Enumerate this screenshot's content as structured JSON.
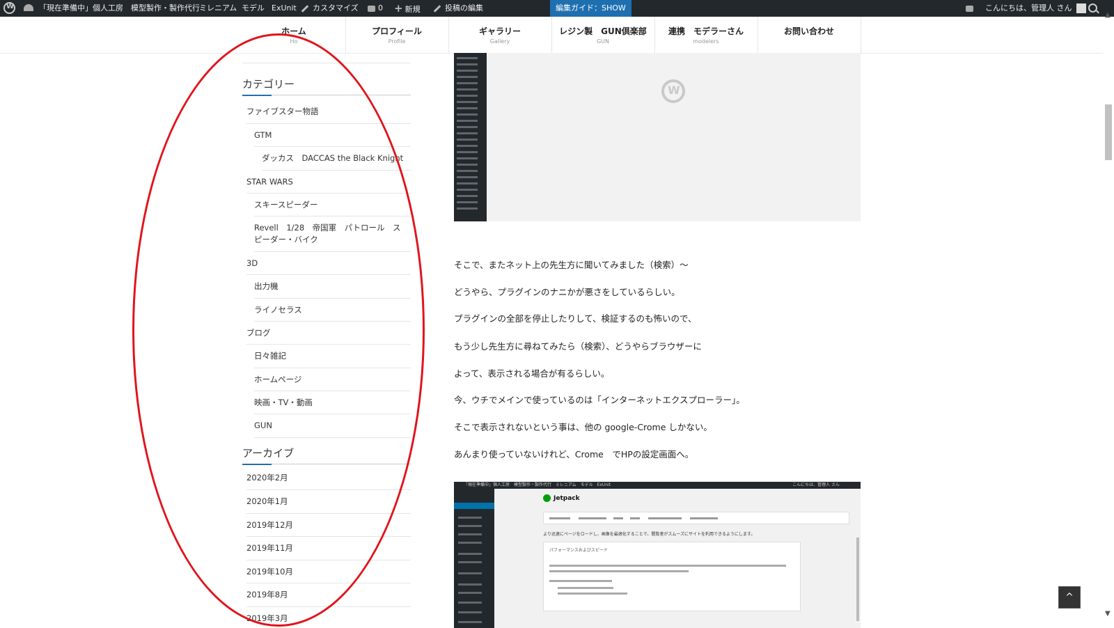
{
  "admin_bar": {
    "site_name": "「現在準備中」個人工房　模型製作・製作代行",
    "links": [
      "ミレニアム",
      "モデル",
      "ExUnit"
    ],
    "customize": "カスタマイズ",
    "comments_count": "0",
    "new_label": "新規",
    "edit_post": "投稿の編集",
    "guide": "編集ガイド：SHOW",
    "greeting": "こんにちは、管理人 さん",
    "icons": [
      "wordpress-logo-icon",
      "dashboard-gauge-icon",
      "brush-icon",
      "comment-icon",
      "plus-icon",
      "pencil-icon",
      "notification-icon",
      "avatar-icon",
      "search-icon"
    ]
  },
  "nav": [
    {
      "label": "ホーム",
      "sub": "Ho"
    },
    {
      "label": "プロフィール",
      "sub": "Profile"
    },
    {
      "label": "ギャラリー",
      "sub": "Gallery"
    },
    {
      "label": "レジン製　GUN倶楽部",
      "sub": "GUN"
    },
    {
      "label": "連携　モデラーさん",
      "sub": "modelers"
    },
    {
      "label": "お問い合わせ",
      "sub": ""
    }
  ],
  "sidebar": {
    "categories_title": "カテゴリー",
    "categories": [
      {
        "label": "ファイブスター物語"
      },
      {
        "label": "GTM"
      },
      {
        "label": "ダッカス　DACCAS the Black Knight"
      },
      {
        "label": "STAR WARS"
      },
      {
        "label": "スキースピーダー"
      },
      {
        "label": "Revell　1/28　帝国軍　パトロール　スピーダー・バイク"
      },
      {
        "label": "3D"
      },
      {
        "label": "出力機"
      },
      {
        "label": "ライノセラス"
      },
      {
        "label": "ブログ"
      },
      {
        "label": "日々雑記"
      },
      {
        "label": "ホームページ"
      },
      {
        "label": "映画・TV・動画"
      },
      {
        "label": "GUN"
      }
    ],
    "archives_title": "アーカイブ",
    "archives": [
      "2020年2月",
      "2020年1月",
      "2019年12月",
      "2019年11月",
      "2019年10月",
      "2019年8月",
      "2019年3月"
    ]
  },
  "content": {
    "paragraphs": [
      "そこで、またネット上の先生方に聞いてみました（検索）～",
      "どうやら、プラグインのナニかが悪さをしているらしい。",
      "プラグインの全部を停止したりして、検証するのも怖いので、",
      "もう少し先生方に尋ねてみたら（検索）、どうやらブラウザーに",
      "よって、表示される場合が有るらしい。",
      "今、ウチでメインで使っているのは「インターネットエクスプローラー」。",
      "そこで表示されないという事は、他の google-Crome しかない。",
      "あんまり使っていないけれど、Crome　でHPの設定画面へ。"
    ],
    "screenshot2": {
      "bar_text": "「現在準備中」個人工房　模型製作・製作代行　ミレニアム　モデル　ExUnit",
      "greeting": "こんにちは、管理人 さん",
      "plugin_title": "Jetpack",
      "lead": "より迅速にページをロードし、画像を最適化することで、閲覧者がスムーズにサイトを利用できるようにします。",
      "panel_title": "パフォーマンスおよびスピード"
    }
  },
  "back_to_top": "^"
}
